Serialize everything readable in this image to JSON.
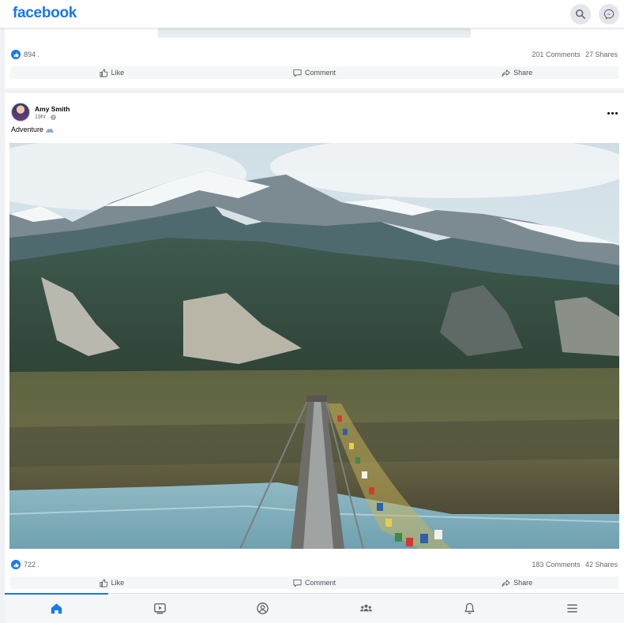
{
  "app": {
    "logo_text": "facebook",
    "brand_color": "#1877f2",
    "icons": {
      "search": "search-icon",
      "messenger": "messenger-icon"
    }
  },
  "posts": [
    {
      "likes": "894 .",
      "comments": "201 Comments",
      "shares": "27 Shares",
      "actions": {
        "like": "Like",
        "comment": "Comment",
        "share": "Share"
      }
    },
    {
      "author": "Amy Smith",
      "meta": "19hr .",
      "text": "Adventure",
      "image": "suspension bridge with prayer flags over river, snowy mountains",
      "likes": "722 .",
      "comments": "183 Comments",
      "shares": "42 Shares",
      "actions": {
        "like": "Like",
        "comment": "Comment",
        "share": "Share"
      }
    }
  ],
  "bottom_nav": [
    {
      "name": "home-icon",
      "active": true
    },
    {
      "name": "watch-icon",
      "active": false
    },
    {
      "name": "profile-icon",
      "active": false
    },
    {
      "name": "groups-icon",
      "active": false
    },
    {
      "name": "notifications-icon",
      "active": false
    },
    {
      "name": "menu-icon",
      "active": false
    }
  ]
}
